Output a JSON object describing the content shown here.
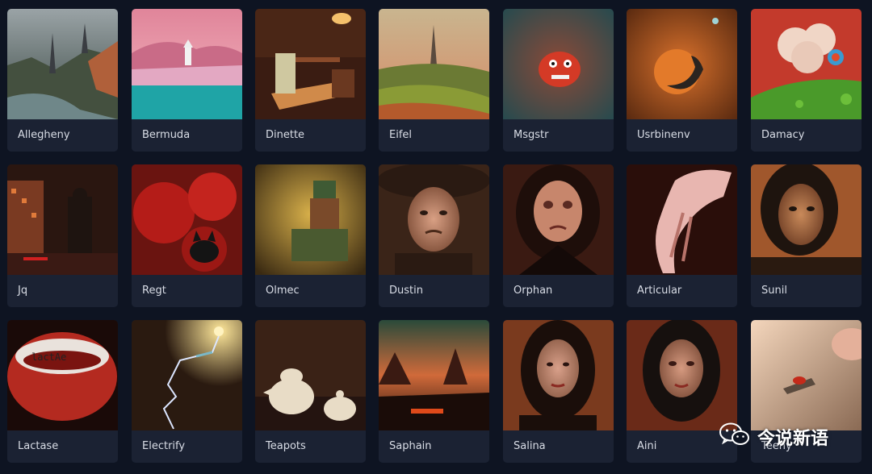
{
  "gallery": {
    "items": [
      {
        "label": "Allegheny",
        "art": "gothic-valley-art"
      },
      {
        "label": "Bermuda",
        "art": "pink-island-coast-art"
      },
      {
        "label": "Dinette",
        "art": "dining-chair-table-art"
      },
      {
        "label": "Eifel",
        "art": "tower-landscape-art"
      },
      {
        "label": "Msgstr",
        "art": "red-creature-art"
      },
      {
        "label": "Usrbinenv",
        "art": "orange-planet-art"
      },
      {
        "label": "Damacy",
        "art": "green-hill-cloud-art"
      },
      {
        "label": "Jq",
        "art": "dark-city-figure-art"
      },
      {
        "label": "Regt",
        "art": "red-poppies-cat-art"
      },
      {
        "label": "Olmec",
        "art": "olmec-statue-art"
      },
      {
        "label": "Dustin",
        "art": "man-with-hat-portrait-art"
      },
      {
        "label": "Orphan",
        "art": "crying-girl-portrait-art"
      },
      {
        "label": "Articular",
        "art": "bent-hand-art"
      },
      {
        "label": "Sunil",
        "art": "long-hair-man-portrait-art"
      },
      {
        "label": "Lactase",
        "art": "red-cup-text-art"
      },
      {
        "label": "Electrify",
        "art": "lightning-bulb-art"
      },
      {
        "label": "Teapots",
        "art": "white-teapots-art"
      },
      {
        "label": "Saphain",
        "art": "red-temple-landscape-art"
      },
      {
        "label": "Salina",
        "art": "woman-with-markings-portrait-art"
      },
      {
        "label": "Aini",
        "art": "woman-with-dark-hair-portrait-art"
      },
      {
        "label": "Teeny",
        "art": "tiny-creature-hand-art"
      }
    ]
  },
  "watermark": {
    "text": "今说新语",
    "icon": "wechat-icon"
  }
}
